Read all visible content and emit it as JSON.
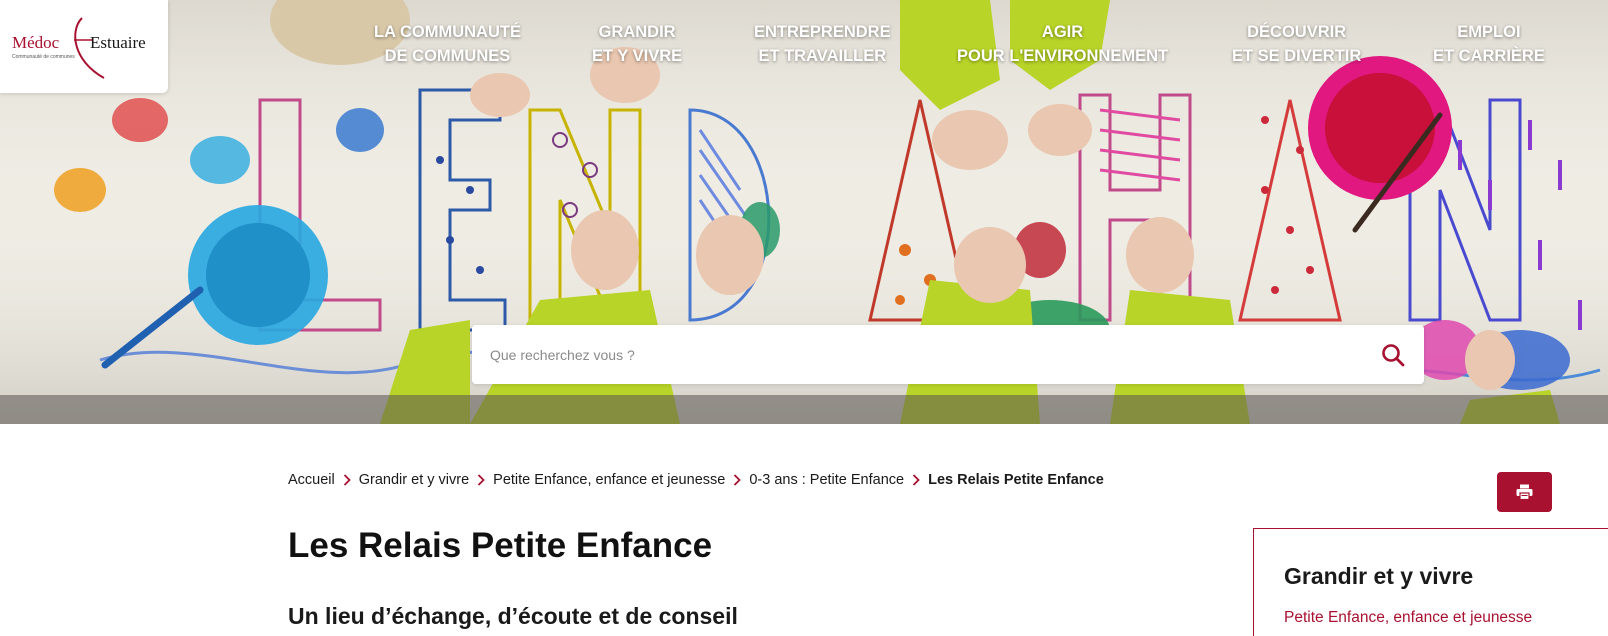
{
  "logo": {
    "text_left": "Médoc",
    "text_right": "Estuaire",
    "tagline": "Communauté de communes"
  },
  "nav": [
    {
      "line1": "LA COMMUNAUTÉ",
      "line2": "DE COMMUNES"
    },
    {
      "line1": "GRANDIR",
      "line2": "ET Y VIVRE"
    },
    {
      "line1": "ENTREPRENDRE",
      "line2": "ET TRAVAILLER"
    },
    {
      "line1": "AGIR",
      "line2": "POUR L'ENVIRONNEMENT"
    },
    {
      "line1": "DÉCOUVRIR",
      "line2": "ET SE DIVERTIR"
    },
    {
      "line1": "EMPLOI",
      "line2": "ET CARRIÈRE"
    }
  ],
  "search": {
    "placeholder": "Que recherchez vous ?",
    "icon": "search-icon"
  },
  "breadcrumb": [
    "Accueil",
    "Grandir et y vivre",
    "Petite Enfance, enfance et jeunesse",
    "0-3 ans : Petite Enfance",
    "Les Relais Petite Enfance"
  ],
  "print_icon": "printer-icon",
  "main": {
    "title": "Les Relais Petite Enfance",
    "subtitle": "Un lieu d’échange, d’écoute et de conseil"
  },
  "side_panel": {
    "title": "Grandir et y vivre",
    "link": "Petite Enfance, enfance et jeunesse"
  },
  "colors": {
    "brand": "#a8112f",
    "text": "#1a1a1a"
  }
}
